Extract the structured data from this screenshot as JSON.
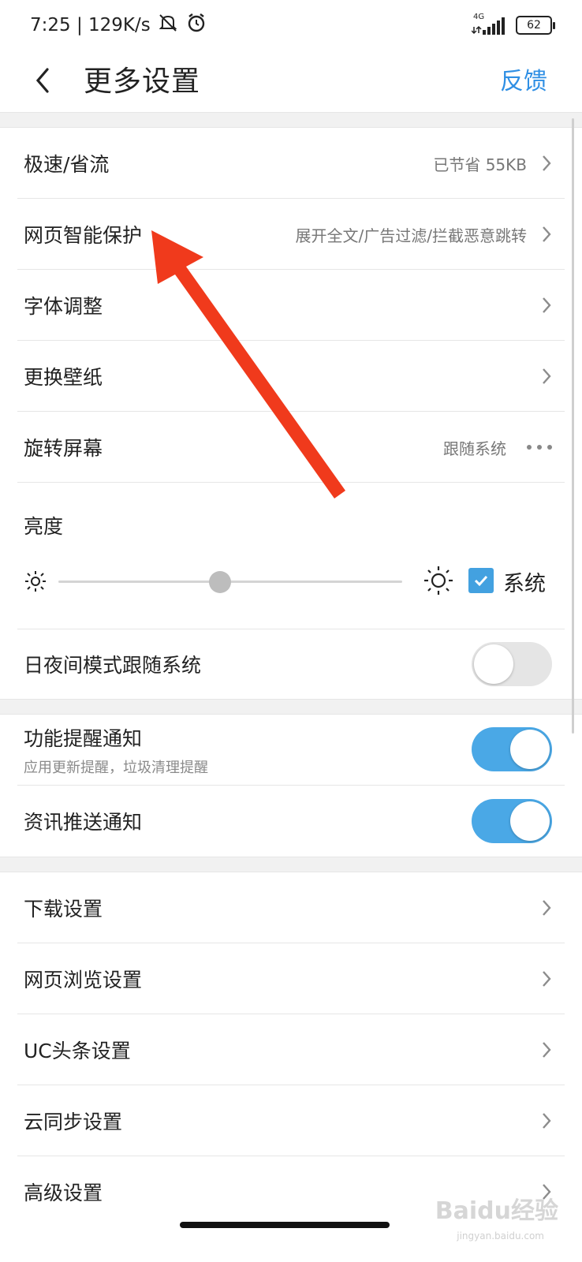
{
  "status_bar": {
    "time_speed": "7:25 | 129K/s",
    "network": "4G",
    "battery": "62"
  },
  "header": {
    "title": "更多设置",
    "feedback": "反馈"
  },
  "rows": {
    "speed": {
      "label": "极速/省流",
      "value": "已节省 55KB"
    },
    "protect": {
      "label": "网页智能保护",
      "value": "展开全文/广告过滤/拦截恶意跳转"
    },
    "font": {
      "label": "字体调整"
    },
    "wallpaper": {
      "label": "更换壁纸"
    },
    "rotate": {
      "label": "旋转屏幕",
      "value": "跟随系统"
    },
    "brightness": {
      "label": "亮度",
      "system_label": "系统",
      "level": 0.47,
      "system_checked": true
    },
    "night": {
      "label": "日夜间模式跟随系统",
      "on": false
    },
    "func_notify": {
      "label": "功能提醒通知",
      "sub": "应用更新提醒，垃圾清理提醒",
      "on": true
    },
    "news_push": {
      "label": "资讯推送通知",
      "on": true
    },
    "download": {
      "label": "下载设置"
    },
    "browse": {
      "label": "网页浏览设置"
    },
    "uc_news": {
      "label": "UC头条设置"
    },
    "cloud_sync": {
      "label": "云同步设置"
    },
    "advanced": {
      "label": "高级设置"
    }
  },
  "watermark": {
    "text": "Baidu经验",
    "sub": "jingyan.baidu.com"
  },
  "colors": {
    "accent": "#2f8fe4",
    "toggle_on": "#4aa8e6",
    "annotation_arrow": "#f03a1c"
  }
}
